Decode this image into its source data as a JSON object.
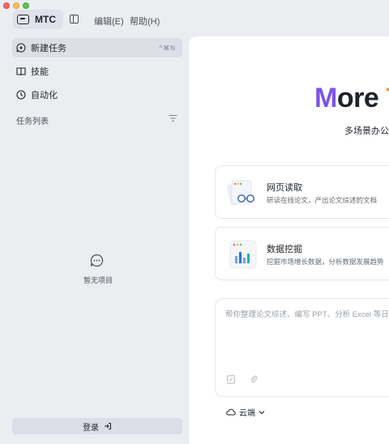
{
  "header": {
    "brand": "MTC",
    "menu_edit": "编辑(E)",
    "menu_help": "帮助(H)"
  },
  "sidebar": {
    "new_task": "新建任务",
    "new_task_shortcut": "^⌘N",
    "skills": "技能",
    "automation": "自动化",
    "task_list": "任务列表",
    "empty": "暂无项目",
    "login": "登录"
  },
  "main": {
    "hero_first": "M",
    "hero_rest": "ore ",
    "hero_next": "T",
    "subtitle": "多场景办公",
    "cards": [
      {
        "title": "网页读取",
        "desc": "研读在线论文，产出论文综述的文档"
      },
      {
        "title": "数据挖掘",
        "desc": "挖掘市场增长数据，分析数据发展趋势"
      }
    ],
    "composer_placeholder": "帮你整理论文综述、编写 PPT、分析 Excel 等日",
    "model_select": "云端"
  },
  "colors": {
    "accent_purple": "#7a55e8",
    "accent_orange": "#e8a33a",
    "sidebar_bg": "#ecedf1"
  }
}
